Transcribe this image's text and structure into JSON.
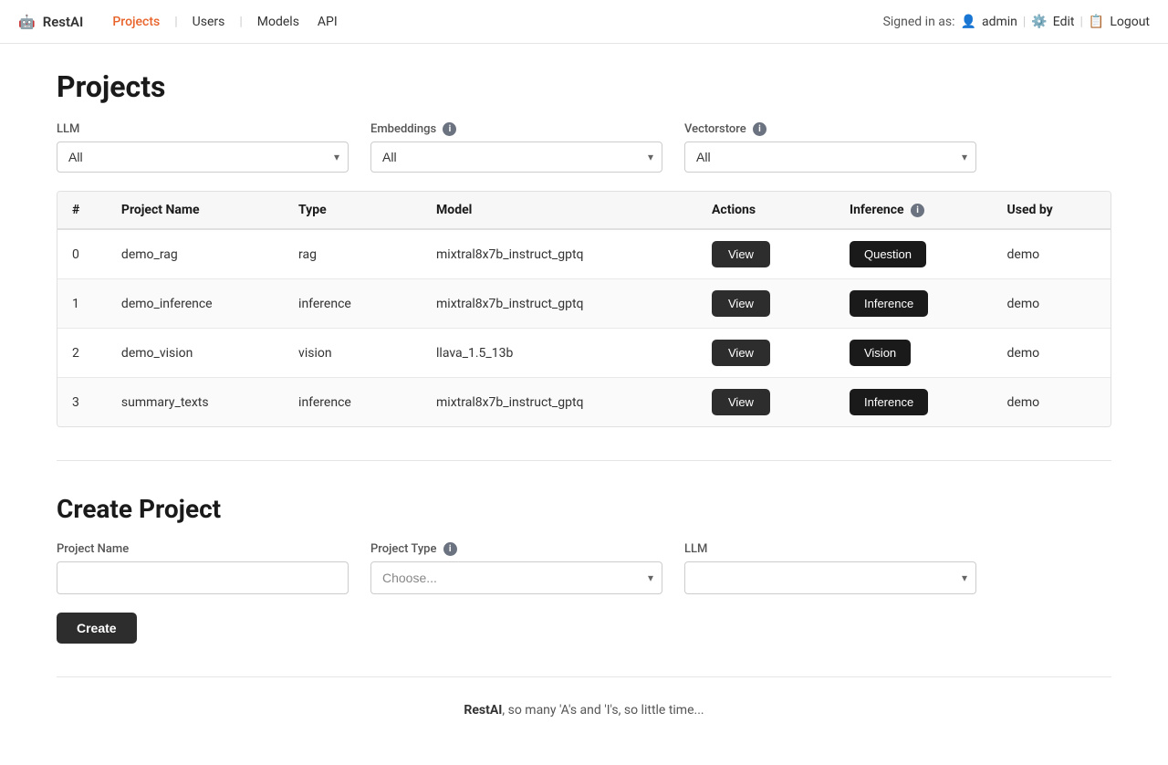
{
  "app": {
    "logo_text": "RestAI",
    "logo_icon": "🤖"
  },
  "nav": {
    "links": [
      {
        "label": "Projects",
        "active": true
      },
      {
        "label": "Users",
        "active": false
      },
      {
        "label": "Models",
        "active": false
      },
      {
        "label": "API",
        "active": false
      }
    ],
    "signed_in_prefix": "Signed in as:",
    "user_icon": "👤",
    "username": "admin",
    "edit_label": "Edit",
    "edit_icon": "⚙️",
    "logout_label": "Logout",
    "logout_icon": "📋"
  },
  "projects_section": {
    "title": "Projects",
    "llm_label": "LLM",
    "embeddings_label": "Embeddings",
    "vectorstore_label": "Vectorstore",
    "llm_default": "All",
    "embeddings_default": "All",
    "vectorstore_default": "All",
    "info_icon_label": "i",
    "table": {
      "columns": [
        "#",
        "Project Name",
        "Type",
        "Model",
        "Actions",
        "Inference",
        "Used by"
      ],
      "rows": [
        {
          "num": "0",
          "name": "demo_rag",
          "type": "rag",
          "model": "mixtral8x7b_instruct_gptq",
          "action_label": "View",
          "inference_label": "Question",
          "used_by": "demo"
        },
        {
          "num": "1",
          "name": "demo_inference",
          "type": "inference",
          "model": "mixtral8x7b_instruct_gptq",
          "action_label": "View",
          "inference_label": "Inference",
          "used_by": "demo"
        },
        {
          "num": "2",
          "name": "demo_vision",
          "type": "vision",
          "model": "llava_1.5_13b",
          "action_label": "View",
          "inference_label": "Vision",
          "used_by": "demo"
        },
        {
          "num": "3",
          "name": "summary_texts",
          "type": "inference",
          "model": "mixtral8x7b_instruct_gptq",
          "action_label": "View",
          "inference_label": "Inference",
          "used_by": "demo"
        }
      ]
    }
  },
  "create_section": {
    "title": "Create Project",
    "project_name_label": "Project Name",
    "project_name_placeholder": "",
    "project_type_label": "Project Type",
    "project_type_placeholder": "Choose...",
    "llm_label": "LLM",
    "llm_placeholder": "",
    "create_button_label": "Create",
    "info_icon_label": "i"
  },
  "footer": {
    "brand": "RestAI",
    "text": ", so many 'A's and 'I's, so little time..."
  }
}
